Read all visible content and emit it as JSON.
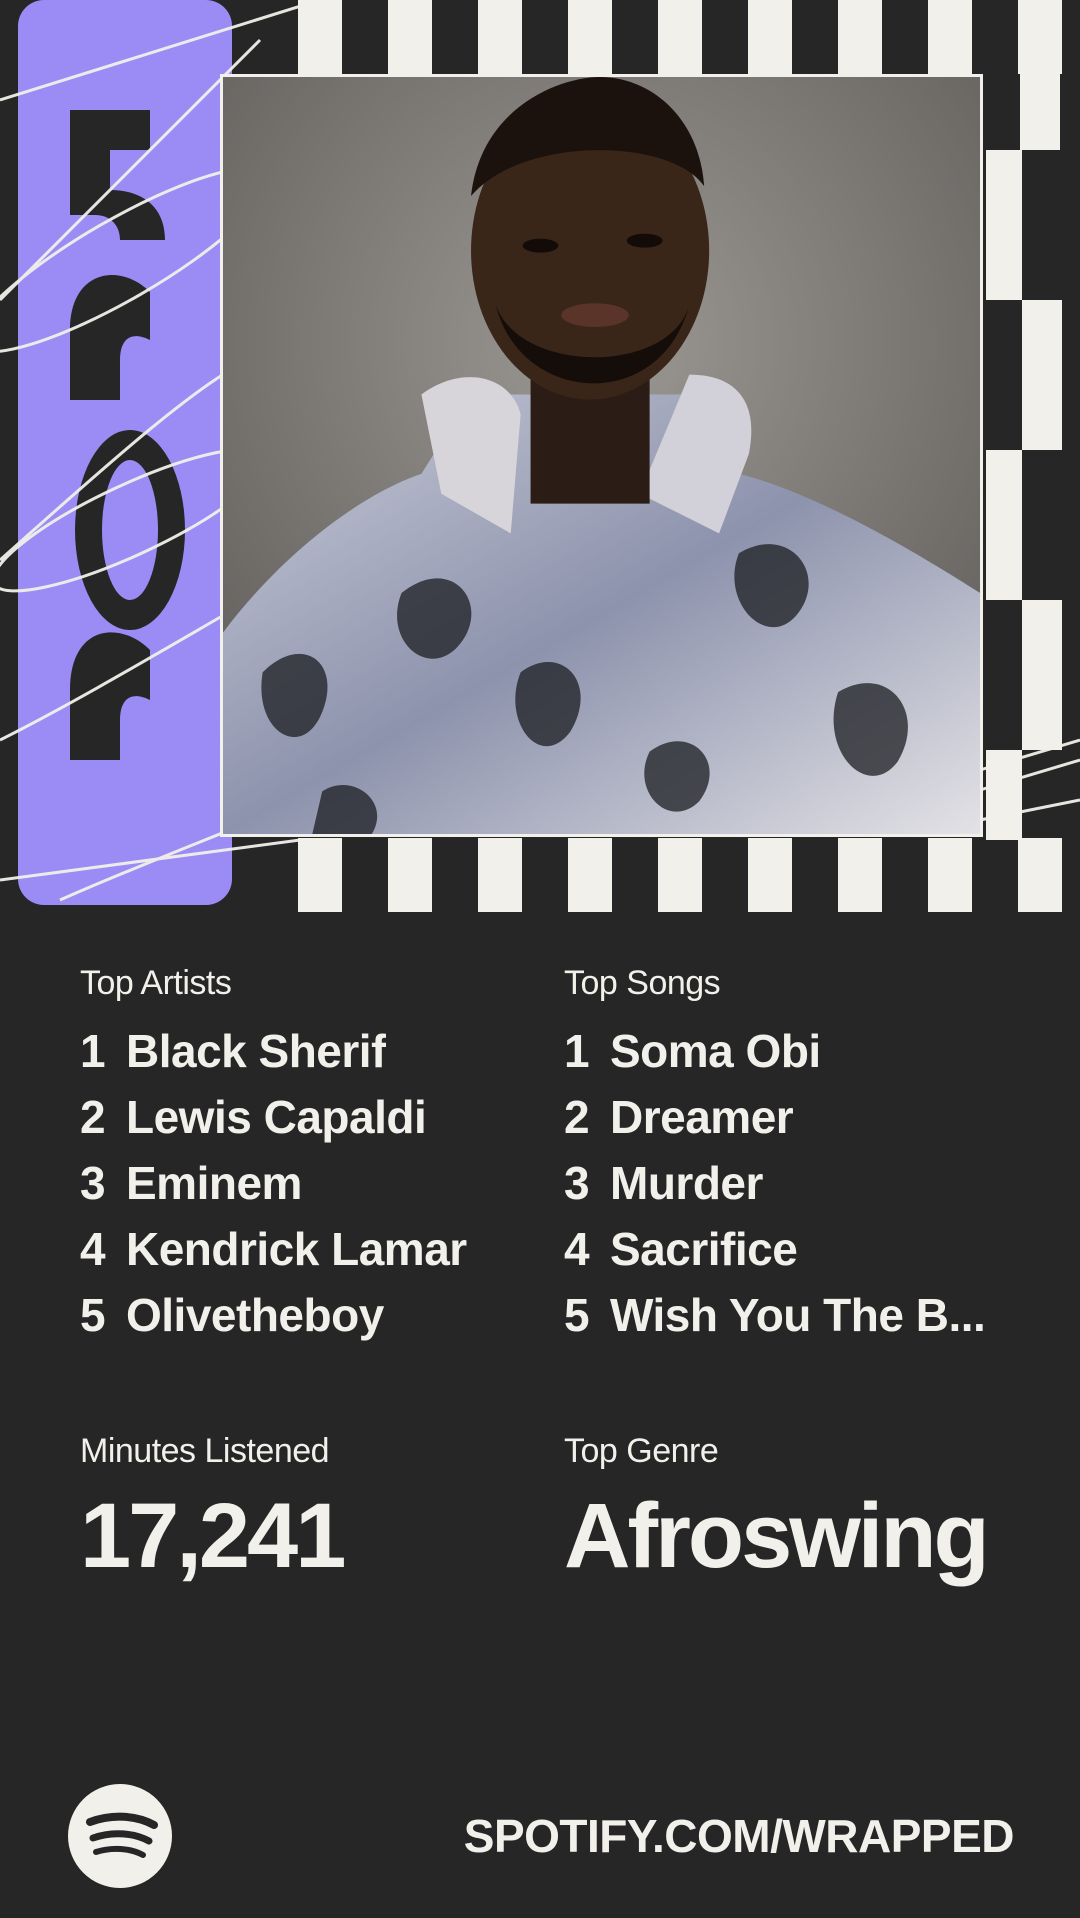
{
  "year_badge": "2025",
  "photo": {
    "subject": "artist-portrait"
  },
  "top_artists": {
    "label": "Top Artists",
    "items": [
      {
        "rank": "1",
        "name": "Black Sherif"
      },
      {
        "rank": "2",
        "name": "Lewis Capaldi"
      },
      {
        "rank": "3",
        "name": "Eminem"
      },
      {
        "rank": "4",
        "name": "Kendrick Lamar"
      },
      {
        "rank": "5",
        "name": "Olivetheboy"
      }
    ]
  },
  "top_songs": {
    "label": "Top Songs",
    "items": [
      {
        "rank": "1",
        "name": "Soma Obi"
      },
      {
        "rank": "2",
        "name": "Dreamer"
      },
      {
        "rank": "3",
        "name": "Murder"
      },
      {
        "rank": "4",
        "name": "Sacrifice"
      },
      {
        "rank": "5",
        "name": "Wish You The B..."
      }
    ]
  },
  "minutes": {
    "label": "Minutes Listened",
    "value": "17,241"
  },
  "genre": {
    "label": "Top Genre",
    "value": "Afroswing"
  },
  "footer": {
    "url": "SPOTIFY.COM/WRAPPED",
    "logo_icon": "spotify-logo-icon"
  },
  "colors": {
    "background": "#262626",
    "text": "#f2f0ea",
    "accent_purple": "#9a8cf4"
  }
}
